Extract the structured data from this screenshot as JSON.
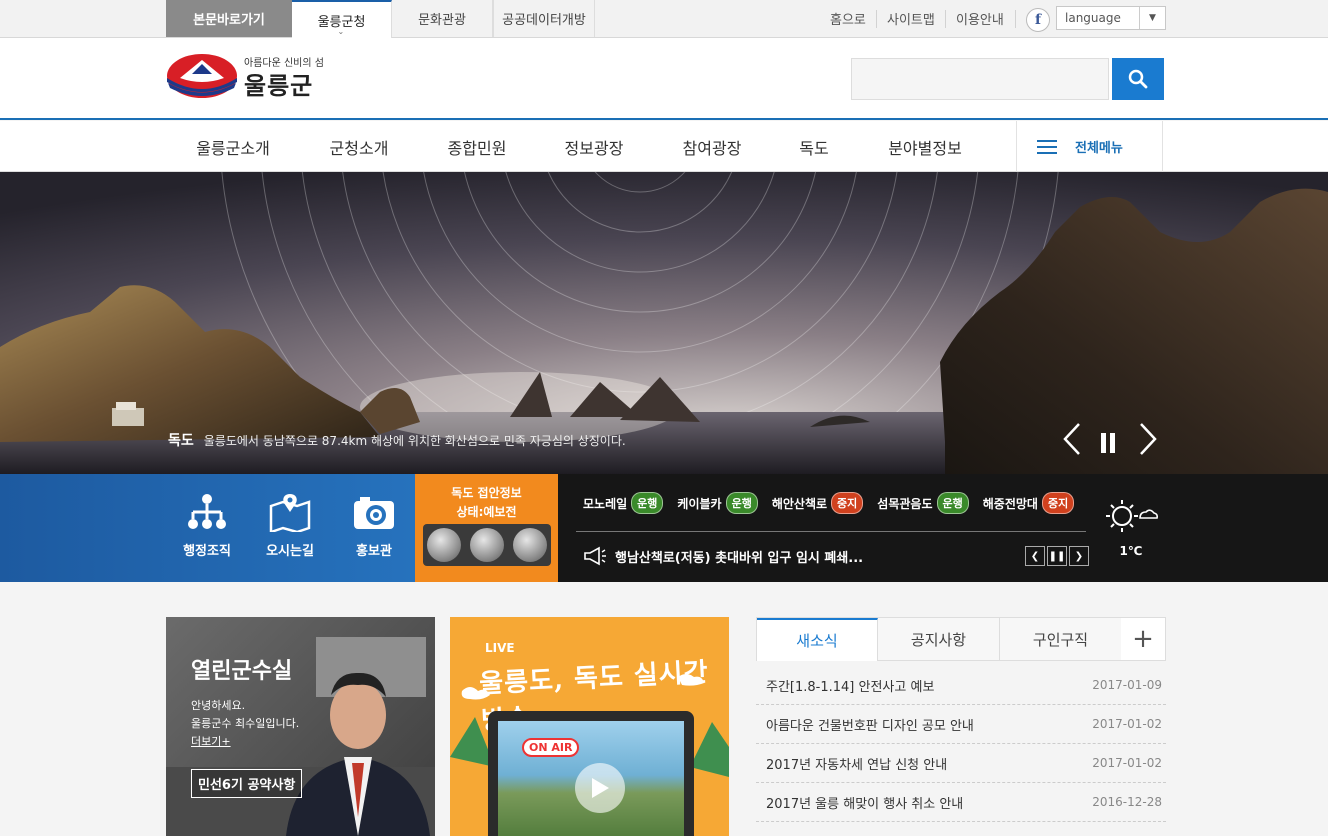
{
  "topbar": {
    "skip_label": "본문바로가기",
    "site_tabs": [
      "울릉군청",
      "문화관광",
      "공공데이터개방"
    ],
    "util_links": [
      "홈으로",
      "사이트맵",
      "이용안내"
    ],
    "facebook_glyph": "f",
    "language_label": "language"
  },
  "header": {
    "logo_tagline": "아름다운 신비의 섬",
    "logo_name": "울릉군",
    "search_placeholder": ""
  },
  "gnb": {
    "items": [
      "울릉군소개",
      "군청소개",
      "종합민원",
      "정보광장",
      "참여광장",
      "독도",
      "분야별정보"
    ],
    "all_menu_label": "전체메뉴"
  },
  "hero": {
    "caption_title": "독도",
    "caption_text": "울릉도에서 동남쪽으로 87.4km 해상에 위치한 화산섬으로 민족 자긍심의 상징이다."
  },
  "quick": {
    "links": [
      "행정조직",
      "오시는길",
      "홍보관"
    ],
    "dokdo_title": "독도 접안정보",
    "dokdo_state": "상태:예보전",
    "statuses": [
      {
        "name": "모노레일",
        "state": "운행",
        "color": "#3a8a2a"
      },
      {
        "name": "케이블카",
        "state": "운행",
        "color": "#3a8a2a"
      },
      {
        "name": "해안산책로",
        "state": "중지",
        "color": "#d0411e"
      },
      {
        "name": "섬목관음도",
        "state": "운행",
        "color": "#3a8a2a"
      },
      {
        "name": "해중전망대",
        "state": "중지",
        "color": "#d0411e"
      }
    ],
    "notice": "행남산책로(저동) 촛대바위 입구 임시 폐쇄...",
    "temperature": "1℃"
  },
  "mayor": {
    "title": "열린군수실",
    "line1": "안녕하세요.",
    "line2": "울릉군수 최수일입니다.",
    "more": "더보기+",
    "pledge": "민선6기 공약사항"
  },
  "live": {
    "tag": "LIVE",
    "title": "울릉도, 독도 실시간 방송",
    "onair": "ON AIR"
  },
  "news": {
    "tabs": [
      "새소식",
      "공지사항",
      "구인구직"
    ],
    "items": [
      {
        "title": "주간[1.8-1.14] 안전사고 예보",
        "date": "2017-01-09"
      },
      {
        "title": "아름다운 건물번호판 디자인 공모 안내",
        "date": "2017-01-02"
      },
      {
        "title": "2017년 자동차세 연납 신청 안내",
        "date": "2017-01-02"
      },
      {
        "title": "2017년 울릉 해맞이 행사 취소 안내",
        "date": "2016-12-28"
      }
    ]
  }
}
